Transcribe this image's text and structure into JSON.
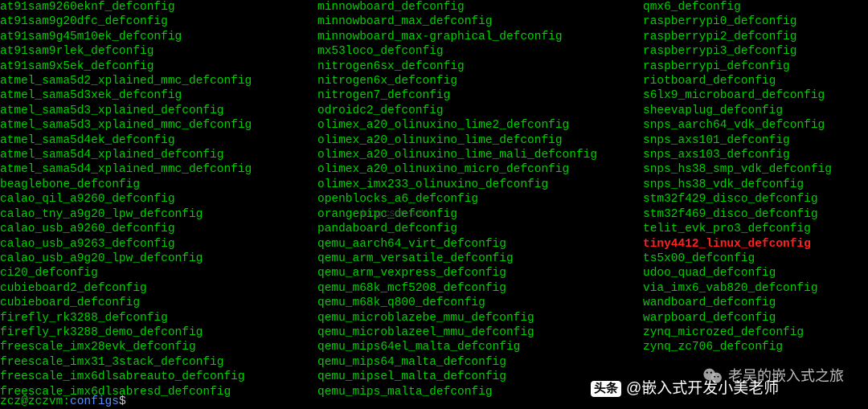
{
  "columns": {
    "col1": [
      "at91sam9260eknf_defconfig",
      "at91sam9g20dfc_defconfig",
      "at91sam9g45m10ek_defconfig",
      "at91sam9rlek_defconfig",
      "at91sam9x5ek_defconfig",
      "atmel_sama5d2_xplained_mmc_defconfig",
      "atmel_sama5d3xek_defconfig",
      "atmel_sama5d3_xplained_defconfig",
      "atmel_sama5d3_xplained_mmc_defconfig",
      "atmel_sama5d4ek_defconfig",
      "atmel_sama5d4_xplained_defconfig",
      "atmel_sama5d4_xplained_mmc_defconfig",
      "beaglebone_defconfig",
      "calao_qil_a9260_defconfig",
      "calao_tny_a9g20_lpw_defconfig",
      "calao_usb_a9260_defconfig",
      "calao_usb_a9263_defconfig",
      "calao_usb_a9g20_lpw_defconfig",
      "ci20_defconfig",
      "cubieboard2_defconfig",
      "cubieboard_defconfig",
      "firefly_rk3288_defconfig",
      "firefly_rk3288_demo_defconfig",
      "freescale_imx28evk_defconfig",
      "freescale_imx31_3stack_defconfig",
      "freescale_imx6dlsabreauto_defconfig",
      "freescale_imx6dlsabresd_defconfig"
    ],
    "col2": [
      "minnowboard_defconfig",
      "minnowboard_max_defconfig",
      "minnowboard_max-graphical_defconfig",
      "mx53loco_defconfig",
      "nitrogen6sx_defconfig",
      "nitrogen6x_defconfig",
      "nitrogen7_defconfig",
      "odroidc2_defconfig",
      "olimex_a20_olinuxino_lime2_defconfig",
      "olimex_a20_olinuxino_lime_defconfig",
      "olimex_a20_olinuxino_lime_mali_defconfig",
      "olimex_a20_olinuxino_micro_defconfig",
      "olimex_imx233_olinuxino_defconfig",
      "openblocks_a6_defconfig",
      "orangepipc_defconfig",
      "pandaboard_defconfig",
      "qemu_aarch64_virt_defconfig",
      "qemu_arm_versatile_defconfig",
      "qemu_arm_vexpress_defconfig",
      "qemu_m68k_mcf5208_defconfig",
      "qemu_m68k_q800_defconfig",
      "qemu_microblazebe_mmu_defconfig",
      "qemu_microblazeel_mmu_defconfig",
      "qemu_mips64el_malta_defconfig",
      "qemu_mips64_malta_defconfig",
      "qemu_mipsel_malta_defconfig",
      "qemu_mips_malta_defconfig"
    ],
    "col3": [
      {
        "text": "qmx6_defconfig",
        "hl": false
      },
      {
        "text": "raspberrypi0_defconfig",
        "hl": false
      },
      {
        "text": "raspberrypi2_defconfig",
        "hl": false
      },
      {
        "text": "raspberrypi3_defconfig",
        "hl": false
      },
      {
        "text": "raspberrypi_defconfig",
        "hl": false
      },
      {
        "text": "riotboard_defconfig",
        "hl": false
      },
      {
        "text": "s6lx9_microboard_defconfig",
        "hl": false
      },
      {
        "text": "sheevaplug_defconfig",
        "hl": false
      },
      {
        "text": "snps_aarch64_vdk_defconfig",
        "hl": false
      },
      {
        "text": "snps_axs101_defconfig",
        "hl": false
      },
      {
        "text": "snps_axs103_defconfig",
        "hl": false
      },
      {
        "text": "snps_hs38_smp_vdk_defconfig",
        "hl": false
      },
      {
        "text": "snps_hs38_vdk_defconfig",
        "hl": false
      },
      {
        "text": "stm32f429_disco_defconfig",
        "hl": false
      },
      {
        "text": "stm32f469_disco_defconfig",
        "hl": false
      },
      {
        "text": "telit_evk_pro3_defconfig",
        "hl": false
      },
      {
        "text": "tiny4412_linux_defconfig",
        "hl": true
      },
      {
        "text": "ts5x00_defconfig",
        "hl": false
      },
      {
        "text": "udoo_quad_defconfig",
        "hl": false
      },
      {
        "text": "via_imx6_vab820_defconfig",
        "hl": false
      },
      {
        "text": "wandboard_defconfig",
        "hl": false
      },
      {
        "text": "warpboard_defconfig",
        "hl": false
      },
      {
        "text": "zynq_microzed_defconfig",
        "hl": false
      },
      {
        "text": "zynq_zc706_defconfig",
        "hl": false
      }
    ]
  },
  "prompt": {
    "user_host": "zcz@zczvm",
    "colon": ":",
    "path": "configs",
    "dollar": "$"
  },
  "watermarks": {
    "url": "blog.csdn.net/",
    "wechat": "老吴的嵌入式之旅",
    "toutiao_prefix": "头条",
    "toutiao": "@嵌入式开发小美老师"
  }
}
